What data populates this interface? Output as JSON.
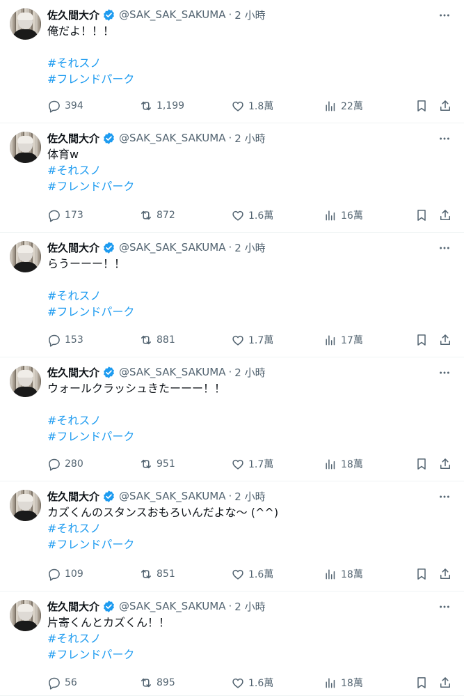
{
  "tweets": [
    {
      "name": "佐久間大介",
      "handle": "@SAK_SAK_SAKUMA",
      "separator": "·",
      "time": "2 小時",
      "lines": [
        "俺だよ！！！",
        "",
        "#それスノ",
        "#フレンドパーク"
      ],
      "replies": "394",
      "retweets": "1,199",
      "likes": "1.8萬",
      "views": "22萬"
    },
    {
      "name": "佐久間大介",
      "handle": "@SAK_SAK_SAKUMA",
      "separator": "·",
      "time": "2 小時",
      "lines": [
        "体育w",
        "#それスノ",
        "#フレンドパーク"
      ],
      "replies": "173",
      "retweets": "872",
      "likes": "1.6萬",
      "views": "16萬"
    },
    {
      "name": "佐久間大介",
      "handle": "@SAK_SAK_SAKUMA",
      "separator": "·",
      "time": "2 小時",
      "lines": [
        "らうーーー！！",
        "",
        "#それスノ",
        "#フレンドパーク"
      ],
      "replies": "153",
      "retweets": "881",
      "likes": "1.7萬",
      "views": "17萬"
    },
    {
      "name": "佐久間大介",
      "handle": "@SAK_SAK_SAKUMA",
      "separator": "·",
      "time": "2 小時",
      "lines": [
        "ウォールクラッシュきたーーー！！",
        "",
        "#それスノ",
        "#フレンドパーク"
      ],
      "replies": "280",
      "retweets": "951",
      "likes": "1.7萬",
      "views": "18萬"
    },
    {
      "name": "佐久間大介",
      "handle": "@SAK_SAK_SAKUMA",
      "separator": "·",
      "time": "2 小時",
      "lines": [
        "カズくんのスタンスおもろいんだよな～ (^^)",
        "#それスノ",
        "#フレンドパーク"
      ],
      "replies": "109",
      "retweets": "851",
      "likes": "1.6萬",
      "views": "18萬"
    },
    {
      "name": "佐久間大介",
      "handle": "@SAK_SAK_SAKUMA",
      "separator": "·",
      "time": "2 小時",
      "lines": [
        "片寄くんとカズくん！！",
        "#それスノ",
        "#フレンドパーク"
      ],
      "replies": "56",
      "retweets": "895",
      "likes": "1.6萬",
      "views": "18萬"
    }
  ],
  "icons": {
    "reply": "reply-icon",
    "retweet": "retweet-icon",
    "like": "heart-icon",
    "views": "analytics-icon",
    "bookmark": "bookmark-icon",
    "share": "share-icon",
    "more": "more-icon",
    "verified": "verified-badge-icon"
  },
  "colors": {
    "accent": "#1d9bf0",
    "text": "#0f1419",
    "muted": "#536471",
    "divider": "#eff3f4"
  }
}
